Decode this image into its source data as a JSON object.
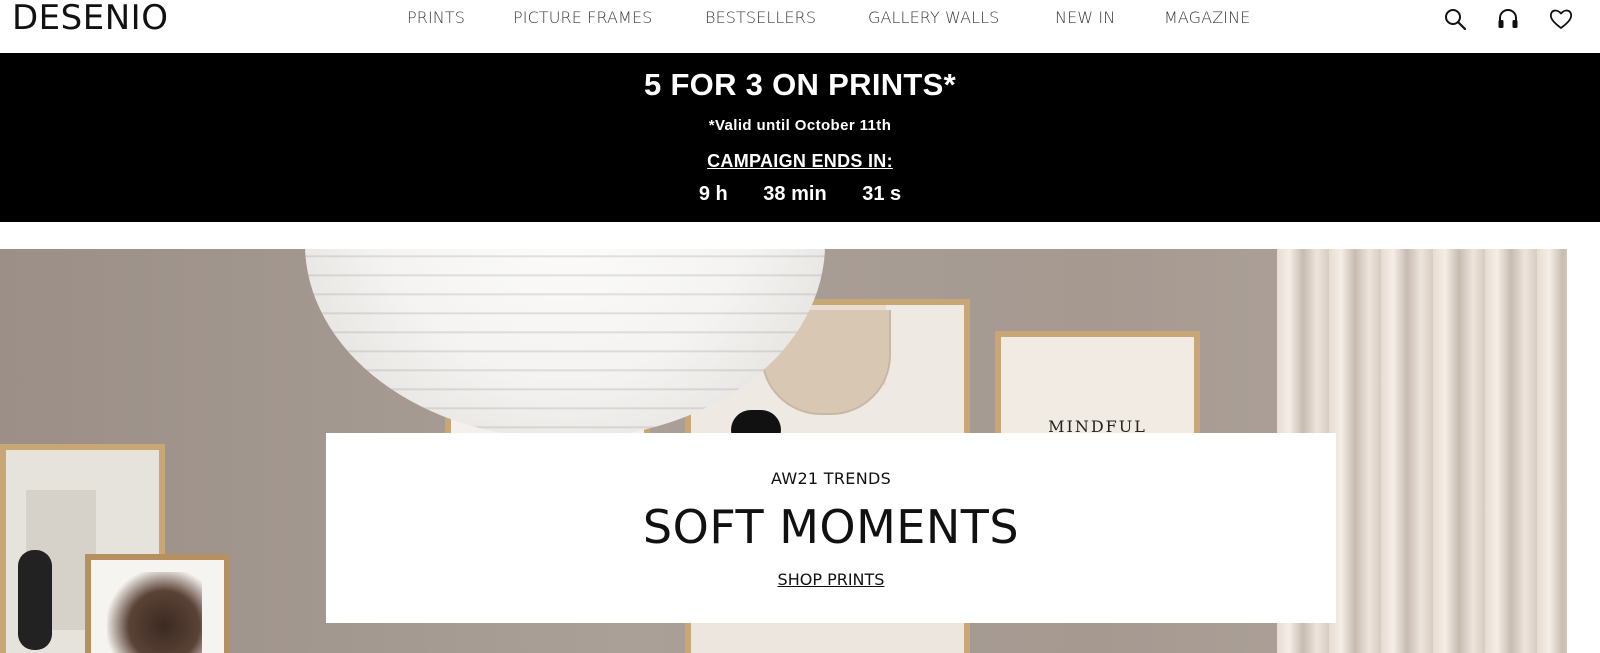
{
  "header": {
    "logo": "DESENIO",
    "nav": [
      {
        "label": "PRINTS"
      },
      {
        "label": "PICTURE FRAMES"
      },
      {
        "label": "BESTSELLERS"
      },
      {
        "label": "GALLERY WALLS"
      },
      {
        "label": "NEW IN"
      },
      {
        "label": "MAGAZINE"
      }
    ],
    "icons": [
      "search-icon",
      "headset-icon",
      "heart-icon"
    ]
  },
  "promo": {
    "title": "5 FOR 3 ON PRINTS*",
    "subtitle": "*Valid until October 11th",
    "ends_label": "CAMPAIGN ENDS IN:",
    "countdown": {
      "hours": "9 h",
      "minutes": "38 min",
      "seconds": "31 s"
    }
  },
  "hero": {
    "kicker": "AW21 TRENDS",
    "title": "SOFT MOMENTS",
    "cta": "SHOP PRINTS",
    "poster_text": "MINDFUL"
  },
  "colors": {
    "promo_bg": "#000000",
    "promo_text": "#ffffff",
    "wall": "#a3978f"
  }
}
